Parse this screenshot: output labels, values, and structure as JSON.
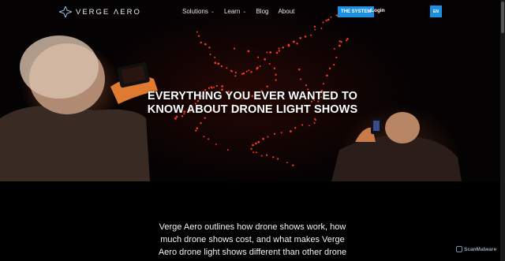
{
  "nav": {
    "logo_text": "VERGE ΛERO",
    "links": [
      {
        "label": "Solutions",
        "dropdown": true
      },
      {
        "label": "Learn",
        "dropdown": true
      },
      {
        "label": "Blog",
        "dropdown": false
      },
      {
        "label": "About",
        "dropdown": false
      }
    ],
    "system_button": "THE SYSTEM",
    "login": "Login",
    "language": "EN"
  },
  "hero": {
    "title_line1": "EVERYTHING YOU EVER WANTED TO",
    "title_line2": "KNOW ABOUT DRONE LIGHT SHOWS"
  },
  "intro": {
    "text": "Verge Aero outlines how drone shows work, how much drone shows cost, and what makes Verge Aero drone light shows different than other drone"
  },
  "watermark": "ScanMalware",
  "colors": {
    "accent": "#1c8fe0",
    "drone_light": "#ff3b1f",
    "background": "#000000"
  }
}
